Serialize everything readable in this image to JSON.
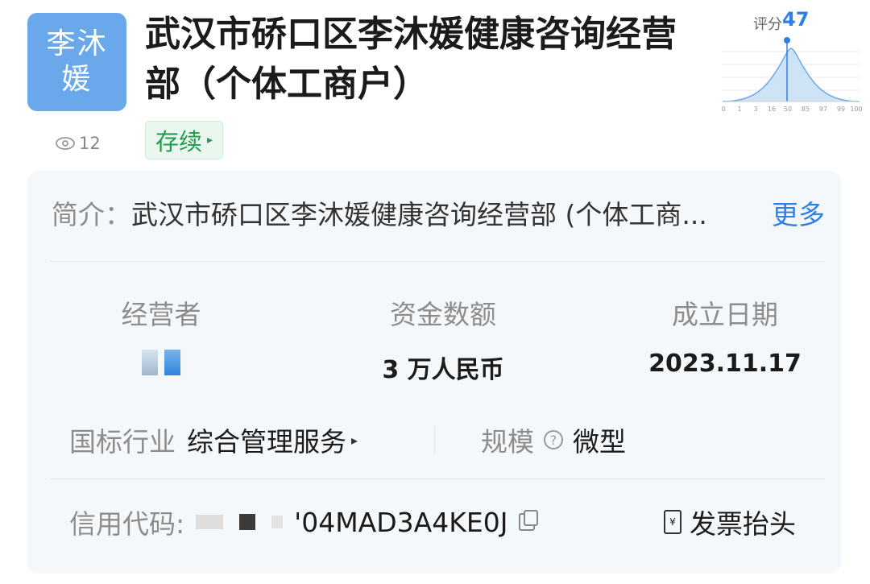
{
  "company": {
    "logo_lines": [
      "李沐",
      "媛"
    ],
    "name": "武汉市硚口区李沐媛健康咨询经营部（个体工商户）",
    "status": "存续",
    "views": "12"
  },
  "score": {
    "label": "评分",
    "value": "47",
    "axis_ticks": [
      "0",
      "1",
      "3",
      "16",
      "50",
      "85",
      "97",
      "99",
      "100"
    ]
  },
  "intro": {
    "label": "简介：",
    "text": "武汉市硚口区李沐媛健康咨询经营部 (个体工商...",
    "more": "更多"
  },
  "stats": {
    "operator": {
      "label": "经营者"
    },
    "capital": {
      "label": "资金数额",
      "value": "3 万人民币"
    },
    "founded": {
      "label": "成立日期",
      "value": "2023.11.17"
    }
  },
  "industry": {
    "label": "国标行业",
    "value": "综合管理服务"
  },
  "scale": {
    "label": "规模",
    "value": "微型"
  },
  "credit": {
    "label": "信用代码:",
    "visible_suffix": "'04MAD3A4KE0J"
  },
  "invoice": {
    "label": "发票抬头",
    "icon_glyph": "¥"
  },
  "colors": {
    "accent": "#2f7fe6",
    "logo_bg": "#69a8ea",
    "status_green": "#1f9d4f"
  }
}
